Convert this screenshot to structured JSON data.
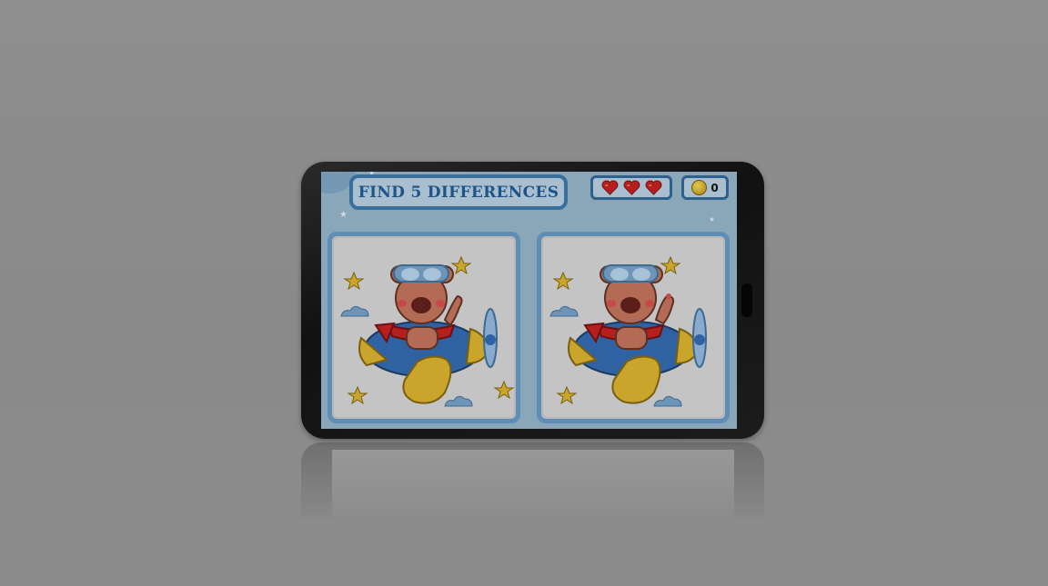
{
  "game": {
    "title": "FIND 5 DIFFERENCES",
    "lives": 3,
    "coins": "0",
    "colors": {
      "frame_blue": "#3a6f9c",
      "title_text": "#1f5486",
      "heart_red": "#b5201f",
      "coin_gold": "#c9a52c"
    },
    "panels": [
      "left-picture",
      "right-picture"
    ]
  },
  "icons": {
    "heart": "heart-icon",
    "coin": "coin-icon",
    "star": "star-icon",
    "cloud": "cloud-icon"
  }
}
